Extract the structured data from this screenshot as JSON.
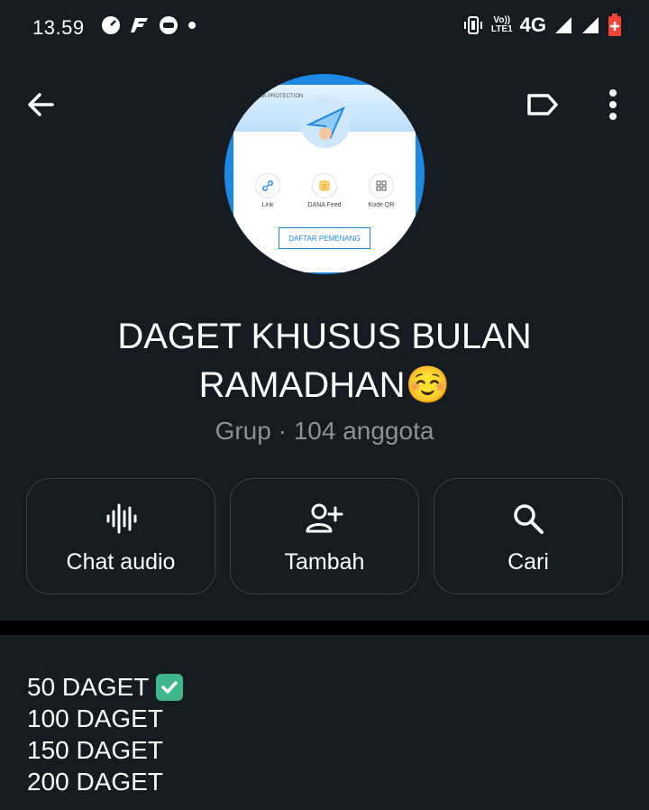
{
  "status_bar": {
    "time": "13.59",
    "network": "4G",
    "volte_top": "Vo))",
    "volte_bottom": "LTE1"
  },
  "header": {
    "title": "DAGET KHUSUS BULAN RAMADHAN☺️",
    "subtitle": "Grup · 104 anggota"
  },
  "avatar": {
    "tag": "DANA PROTECTION",
    "items": [
      {
        "label": "Link",
        "icon": "link-icon"
      },
      {
        "label": "DANA Feed",
        "icon": "feed-icon"
      },
      {
        "label": "Kode QR",
        "icon": "qr-icon"
      }
    ],
    "button_label": "DAFTAR PEMENANG"
  },
  "actions": [
    {
      "label": "Chat audio",
      "icon": "voice-chat-icon"
    },
    {
      "label": "Tambah",
      "icon": "add-user-icon"
    },
    {
      "label": "Cari",
      "icon": "search-icon"
    }
  ],
  "description": {
    "lines": [
      "50 DAGET",
      "100 DAGET",
      "150 DAGET",
      "200 DAGET"
    ],
    "checked_line": 0
  },
  "colors": {
    "background": "#161b21",
    "accent_blue": "#1e88e5",
    "check_green": "#3fb68b",
    "muted_text": "#8a9199"
  }
}
